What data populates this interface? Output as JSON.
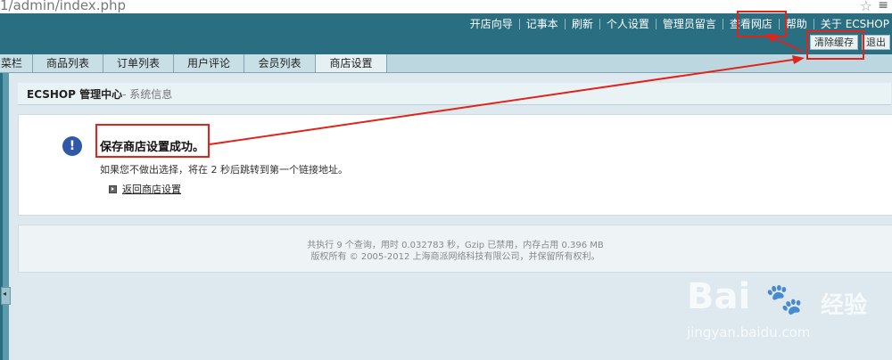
{
  "browser": {
    "url": "1/admin/index.php",
    "star_icon": "☆",
    "menu_icon": "≡"
  },
  "header": {
    "top_links": [
      "开店向导",
      "记事本",
      "刷新",
      "个人设置",
      "管理员留言",
      "查看网店",
      "帮助",
      "关于 ECSHOP"
    ],
    "clear_cache": "清除缓存",
    "logout": "退出",
    "bg_color": "#2a6e82"
  },
  "tabs": [
    "菜栏",
    "商品列表",
    "订单列表",
    "用户评论",
    "会员列表",
    "商店设置"
  ],
  "page": {
    "title": "ECSHOP 管理中心",
    "subtitle": "- 系统信息"
  },
  "message": {
    "title": "保存商店设置成功。",
    "desc": "如果您不做出选择，将在 2 秒后跳转到第一个链接地址。",
    "link": "返回商店设置",
    "icon": "info-icon"
  },
  "footer": {
    "line1": "共执行 9 个查询，用时 0.032783 秒，Gzip 已禁用，内存占用 0.396 MB",
    "line2": "版权所有 © 2005-2012 上海商派网络科技有限公司，并保留所有权利。"
  },
  "annotation_color": "#e2231a",
  "watermark": {
    "brand": "Bai",
    "cn": "经验",
    "url": "jingyan.baidu.com"
  }
}
